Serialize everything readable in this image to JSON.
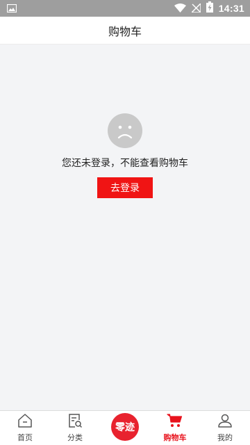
{
  "status_bar": {
    "time": "14:31",
    "icons": [
      "image-icon",
      "wifi-icon",
      "no-signal-icon",
      "battery-charging-icon"
    ]
  },
  "header": {
    "title": "购物车"
  },
  "empty_state": {
    "icon": "sad-face-icon",
    "message": "您还未登录，不能查看购物车",
    "button_label": "去登录"
  },
  "tab_bar": {
    "tabs": [
      {
        "label": "首页",
        "icon": "home-icon",
        "active": false
      },
      {
        "label": "分类",
        "icon": "category-search-icon",
        "active": false
      },
      {
        "label": "零迹",
        "icon": "brand-badge",
        "active": false
      },
      {
        "label": "购物车",
        "icon": "cart-icon",
        "active": true
      },
      {
        "label": "我的",
        "icon": "user-icon",
        "active": false
      }
    ]
  },
  "colors": {
    "accent": "#e8131d",
    "background": "#f3f4f6",
    "status_bar": "#9e9e9e"
  }
}
